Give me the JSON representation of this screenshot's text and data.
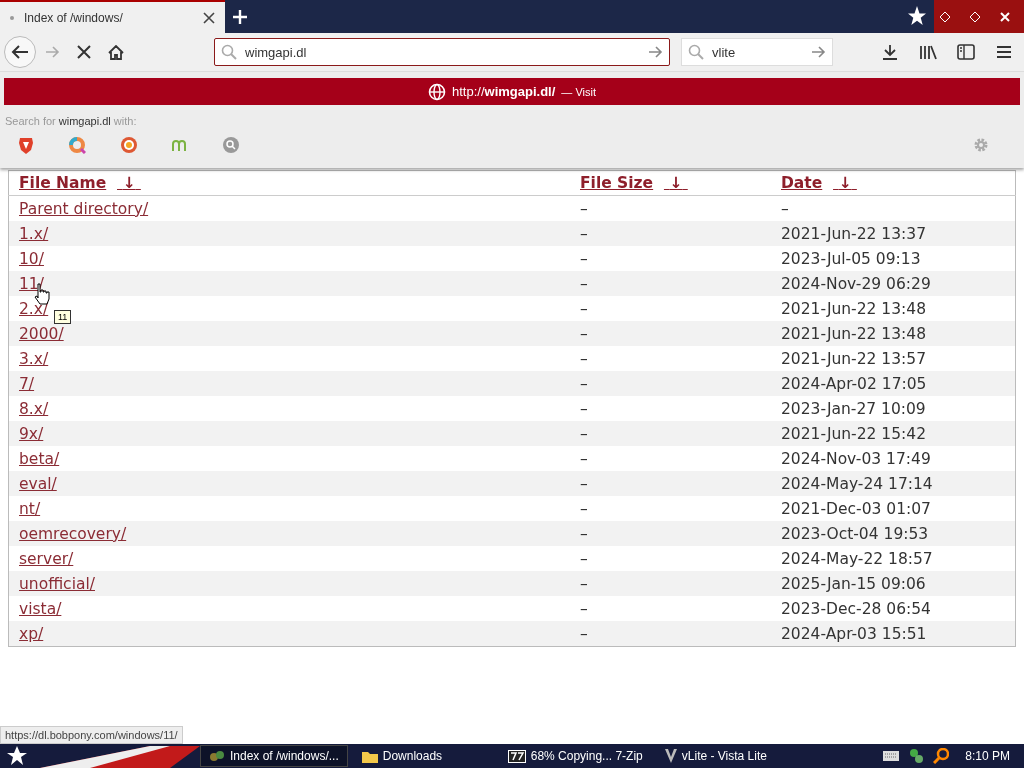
{
  "tabs": [
    {
      "title": "Index of /windows/",
      "selected": true,
      "loading": true
    }
  ],
  "toolbar": {
    "url": "wimgapi.dl",
    "search": "vlite"
  },
  "url_dropdown": {
    "suggestion_url": "http://**wimgapi.dl/**",
    "suggestion_action": "— Visit",
    "search_label": "Search for **wimgapi.dl** with:"
  },
  "table": {
    "columns": [
      {
        "label": "File Name",
        "sort": "↓"
      },
      {
        "label": "File Size",
        "sort": "↓"
      },
      {
        "label": "Date",
        "sort": "↓"
      }
    ],
    "rows": [
      {
        "name": "Parent directory/",
        "size": "–",
        "date": "–"
      },
      {
        "name": "1.x/",
        "size": "–",
        "date": "2021-Jun-22 13:37"
      },
      {
        "name": "10/",
        "size": "–",
        "date": "2023-Jul-05 09:13"
      },
      {
        "name": "11/",
        "size": "–",
        "date": "2024-Nov-29 06:29"
      },
      {
        "name": "2.x/",
        "size": "–",
        "date": "2021-Jun-22 13:48"
      },
      {
        "name": "2000/",
        "size": "–",
        "date": "2021-Jun-22 13:48"
      },
      {
        "name": "3.x/",
        "size": "–",
        "date": "2021-Jun-22 13:57"
      },
      {
        "name": "7/",
        "size": "–",
        "date": "2024-Apr-02 17:05"
      },
      {
        "name": "8.x/",
        "size": "–",
        "date": "2023-Jan-27 10:09"
      },
      {
        "name": "9x/",
        "size": "–",
        "date": "2021-Jun-22 15:42"
      },
      {
        "name": "beta/",
        "size": "–",
        "date": "2024-Nov-03 17:49"
      },
      {
        "name": "eval/",
        "size": "–",
        "date": "2024-May-24 17:14"
      },
      {
        "name": "nt/",
        "size": "–",
        "date": "2021-Dec-03 01:07"
      },
      {
        "name": "oemrecovery/",
        "size": "–",
        "date": "2023-Oct-04 19:53"
      },
      {
        "name": "server/",
        "size": "–",
        "date": "2024-May-22 18:57"
      },
      {
        "name": "unofficial/",
        "size": "–",
        "date": "2025-Jan-15 09:06"
      },
      {
        "name": "vista/",
        "size": "–",
        "date": "2023-Dec-28 06:54"
      },
      {
        "name": "xp/",
        "size": "–",
        "date": "2024-Apr-03 15:51"
      }
    ]
  },
  "tooltip": "11",
  "status_url": "https://dl.bobpony.com/windows/11/",
  "taskbar": {
    "items": [
      {
        "kind": "browser",
        "label": "Index of /windows/...",
        "selected": true
      },
      {
        "kind": "folder",
        "label": "Downloads",
        "selected": false
      },
      {
        "kind": "zip",
        "label": "68% Copying... 7-Zip",
        "selected": false
      },
      {
        "kind": "vlite",
        "label": "vLite - Vista Lite",
        "selected": false
      }
    ],
    "clock": "8:10 PM"
  }
}
